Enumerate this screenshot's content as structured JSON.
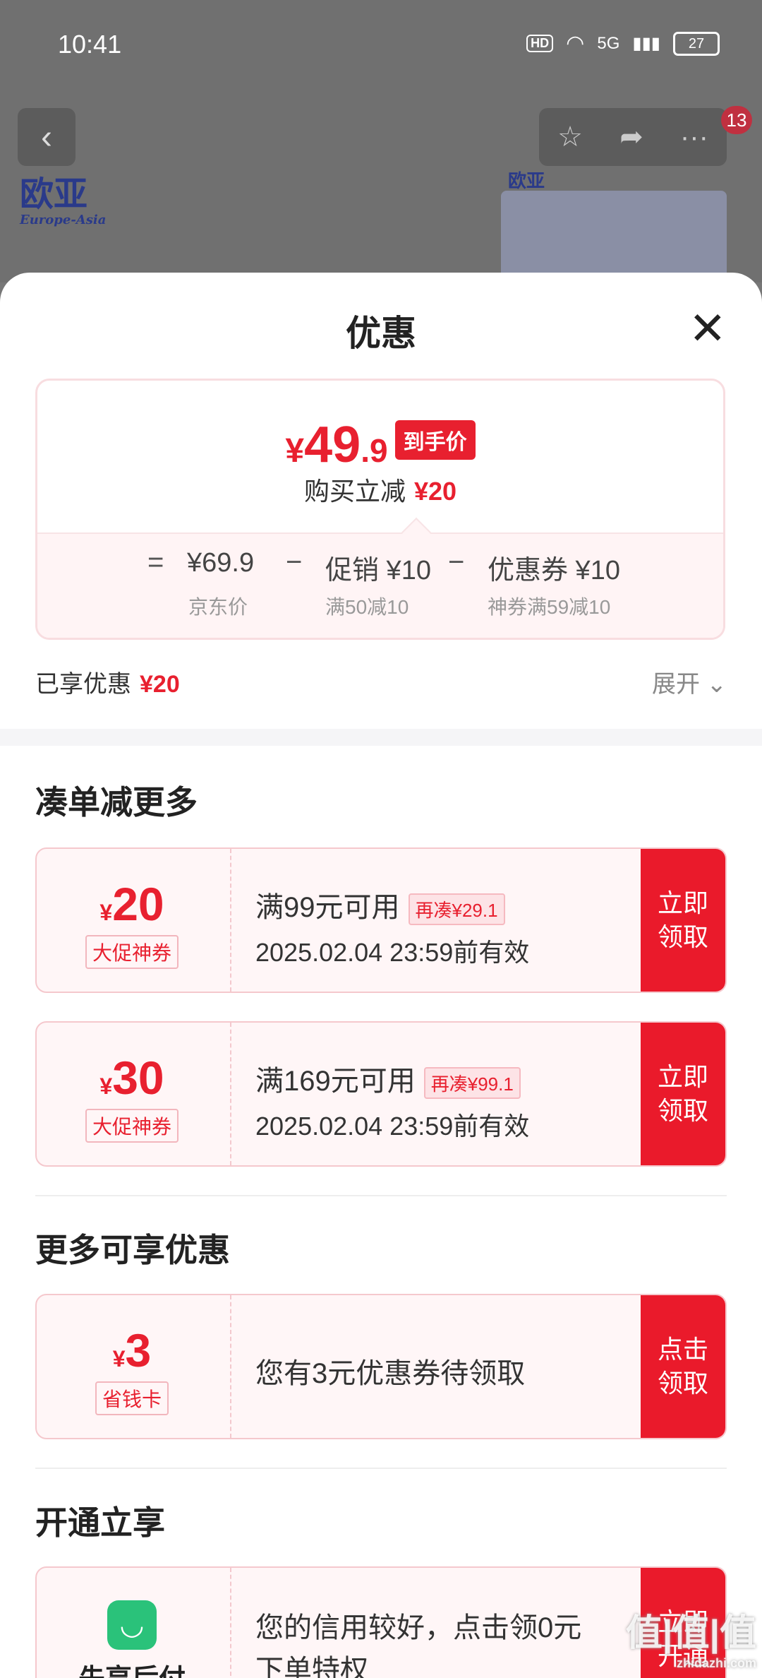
{
  "status": {
    "time": "10:41",
    "network": "5G",
    "battery": "27",
    "hd": "HD"
  },
  "nav": {
    "badge": "13"
  },
  "background": {
    "logo_cn": "欧亚",
    "logo_en": "Europe-Asia",
    "img_logo": "欧亚"
  },
  "sheet": {
    "title": "优惠",
    "final_price": {
      "yen": "¥",
      "int": "49",
      "dec": ".9",
      "tag": "到手价"
    },
    "reduce": {
      "label": "购买立减",
      "amount": "¥20"
    },
    "calc": {
      "eq": "=",
      "items": [
        {
          "value": "¥69.9",
          "sub": "京东价"
        },
        {
          "value": "促销 ¥10",
          "sub": "满50减10"
        },
        {
          "value": "优惠券 ¥10",
          "sub": "神券满59减10"
        }
      ],
      "op": "−"
    },
    "enjoyed": {
      "label": "已享优惠",
      "amount": "¥20"
    },
    "expand": "展开",
    "section1": "凑单减更多",
    "coupons": [
      {
        "yen": "¥",
        "value": "20",
        "label": "大促神券",
        "cond": "满99元可用",
        "more": "再凑¥29.1",
        "expire": "2025.02.04 23:59前有效",
        "btn": "立即领取"
      },
      {
        "yen": "¥",
        "value": "30",
        "label": "大促神券",
        "cond": "满169元可用",
        "more": "再凑¥99.1",
        "expire": "2025.02.04 23:59前有效",
        "btn": "立即领取"
      }
    ],
    "section2": "更多可享优惠",
    "card": {
      "yen": "¥",
      "value": "3",
      "label": "省钱卡",
      "text": "您有3元优惠券待领取",
      "btn": "点击领取"
    },
    "section3": "开通立享",
    "paylater": {
      "name": "先享后付",
      "text1": "您的信用较好，点击领0元",
      "text2": "下单特权",
      "btn": "立即开通"
    }
  },
  "watermark": {
    "main": "值|值|值",
    "sub": "zhidazhi.com"
  }
}
